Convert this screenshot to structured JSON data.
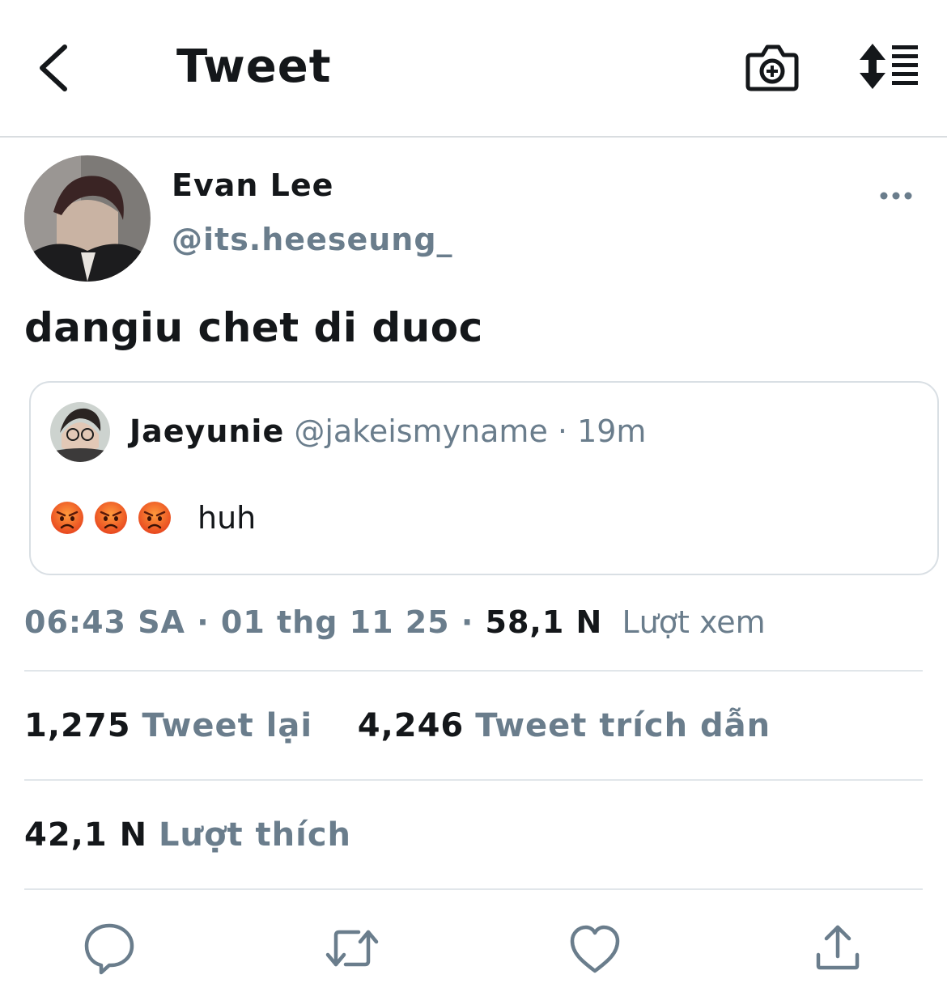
{
  "header": {
    "title": "Tweet",
    "back_icon": "chevron-left-icon",
    "camera_icon": "camera-add-icon",
    "sort_icon": "sort-list-icon"
  },
  "tweet": {
    "author": {
      "display_name": "Evan Lee",
      "handle": "@its.heeseung_"
    },
    "text": "dangiu chet di duoc",
    "quote": {
      "display_name": "Jaeyunie",
      "handle": "@jakeismyname",
      "separator": " · ",
      "time": "19m",
      "emojis": [
        "angry-face-emoji",
        "angry-face-emoji",
        "angry-face-emoji"
      ],
      "text": "huh"
    },
    "meta": {
      "time": "06:43 SA",
      "sep1": " · ",
      "date": "01 thg 11 25",
      "sep2": " · ",
      "views_count": "58,1 N",
      "views_label": "Lượt xem"
    },
    "stats": {
      "retweets_count": "1,275",
      "retweets_label": "Tweet lại",
      "quotes_count": "4,246",
      "quotes_label": "Tweet trích dẫn",
      "likes_count": "42,1 N",
      "likes_label": "Lượt thích"
    }
  },
  "actions": [
    "reply-icon",
    "retweet-icon",
    "like-icon",
    "share-icon"
  ],
  "colors": {
    "text": "#14171a",
    "secondary": "#6a7d8c",
    "border": "#d9dfe4",
    "emoji": "#f26b2a"
  }
}
